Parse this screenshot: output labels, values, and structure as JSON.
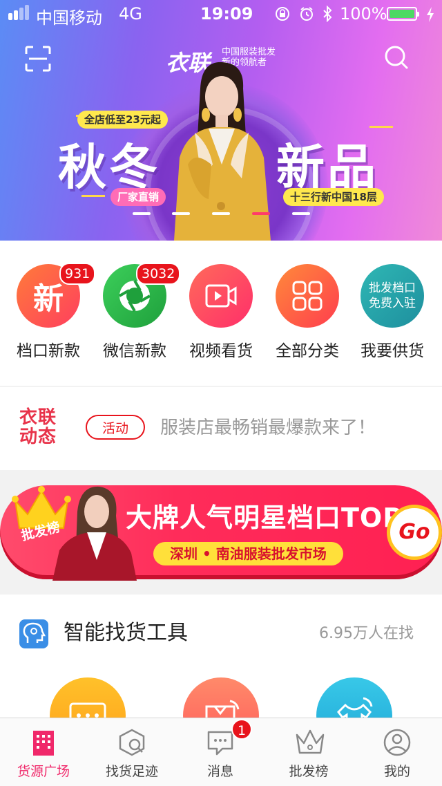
{
  "status_bar": {
    "carrier": "中国移动",
    "network": "4G",
    "time": "19:09",
    "battery": "100%"
  },
  "header": {
    "logo": "衣联",
    "tagline_line1": "中国服装批发",
    "tagline_line2": "新的领航者"
  },
  "hero": {
    "top_pill": "全店低至23元起",
    "headline_left": "秋冬",
    "headline_right": "新品",
    "pill_left": "厂家直销",
    "pill_right": "十三行新中国18层",
    "carousel_count": 5,
    "carousel_active_index": 3
  },
  "quick_menu": [
    {
      "label": "档口新款",
      "glyph": "新",
      "badge": "931",
      "color": "#ff5a4b"
    },
    {
      "label": "微信新款",
      "badge": "3032",
      "color": "#2db84a"
    },
    {
      "label": "视频看货",
      "color": "#ff4b5c"
    },
    {
      "label": "全部分类",
      "color": "#ff5a3c"
    },
    {
      "label": "我要供货",
      "circle_line1": "批发档口",
      "circle_line2": "免费入驻",
      "color": "#26a9a8"
    }
  ],
  "news": {
    "brand_line1": "衣联",
    "brand_line2": "动态",
    "tag": "活动",
    "text": "服装店最畅销最爆款来了！"
  },
  "promo_banner": {
    "crown_label": "批发榜",
    "title": "大牌人气明星档口TOP",
    "subtitle": "深圳 • 南油服装批发市场",
    "go": "Go"
  },
  "smart_tool": {
    "title": "智能找货工具",
    "count": "6.95万人在找"
  },
  "tab_bar": [
    {
      "label": "货源广场",
      "active": true
    },
    {
      "label": "找货足迹"
    },
    {
      "label": "消息",
      "badge": "1"
    },
    {
      "label": "批发榜"
    },
    {
      "label": "我的"
    }
  ],
  "colors": {
    "accent": "#f0286a",
    "badge_red": "#e8141c"
  }
}
